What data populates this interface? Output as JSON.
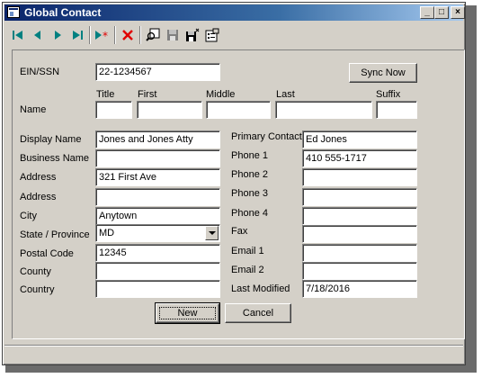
{
  "window": {
    "title": "Global Contact"
  },
  "titlebar_buttons": {
    "minimize": "_",
    "maximize": "□",
    "close": "×"
  },
  "toolbar": {
    "icons": [
      "first-record-icon",
      "previous-record-icon",
      "next-record-icon",
      "last-record-icon",
      "new-record-icon",
      "delete-record-icon",
      "find-icon",
      "save-icon",
      "save-close-icon",
      "properties-icon"
    ]
  },
  "form": {
    "ein_label": "EIN/SSN",
    "ein_value": "22-1234567",
    "sync_button": "Sync Now",
    "name_label": "Name",
    "name_headers": {
      "title": "Title",
      "first": "First",
      "middle": "Middle",
      "last": "Last",
      "suffix": "Suffix"
    },
    "name_values": {
      "title": "",
      "first": "",
      "middle": "",
      "last": "",
      "suffix": ""
    },
    "left": [
      {
        "label": "Display Name",
        "value": "Jones and Jones Atty"
      },
      {
        "label": "Business Name",
        "value": ""
      },
      {
        "label": "Address",
        "value": "321 First Ave"
      },
      {
        "label": "Address",
        "value": ""
      },
      {
        "label": "City",
        "value": "Anytown"
      },
      {
        "label": "State / Province",
        "value": "MD"
      },
      {
        "label": "Postal Code",
        "value": "12345"
      },
      {
        "label": "County",
        "value": ""
      },
      {
        "label": "Country",
        "value": ""
      }
    ],
    "right": [
      {
        "label": "Primary Contact",
        "value": "Ed Jones"
      },
      {
        "label": "Phone 1",
        "value": "410 555-1717"
      },
      {
        "label": "Phone 2",
        "value": ""
      },
      {
        "label": "Phone 3",
        "value": ""
      },
      {
        "label": "Phone 4",
        "value": ""
      },
      {
        "label": "Fax",
        "value": ""
      },
      {
        "label": "Email 1",
        "value": ""
      },
      {
        "label": "Email 2",
        "value": ""
      },
      {
        "label": "Last Modified",
        "value": "7/18/2016"
      }
    ],
    "new_button": "New",
    "cancel_button": "Cancel"
  },
  "colors": {
    "titlebar": "#0a246a",
    "face": "#d4d0c8",
    "nav_arrow": "#008080",
    "delete": "#e00000"
  }
}
